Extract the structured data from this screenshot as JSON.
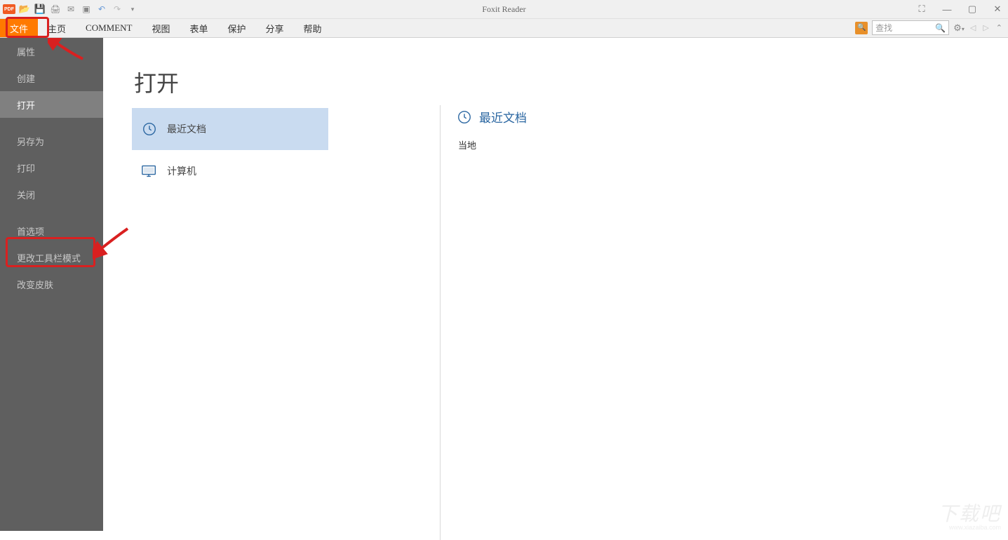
{
  "app": {
    "title": "Foxit Reader"
  },
  "ribbon": {
    "tabs": [
      "文件",
      "主页",
      "COMMENT",
      "视图",
      "表单",
      "保护",
      "分享",
      "帮助"
    ],
    "search_placeholder": "查找"
  },
  "sidebar": {
    "items": [
      {
        "label": "属性"
      },
      {
        "label": "创建"
      },
      {
        "label": "打开",
        "selected": true
      },
      {
        "sep": true
      },
      {
        "label": "另存为"
      },
      {
        "label": "打印"
      },
      {
        "label": "关闭"
      },
      {
        "sep": true
      },
      {
        "label": "首选项"
      },
      {
        "label": "更改工具栏模式"
      },
      {
        "label": "改变皮肤"
      }
    ]
  },
  "main": {
    "title": "打开",
    "open_sources": [
      {
        "label": "最近文档",
        "icon": "clock",
        "active": true
      },
      {
        "label": "计算机",
        "icon": "computer"
      }
    ],
    "recent": {
      "title": "最近文档",
      "subtitle": "当地"
    }
  },
  "watermark": {
    "main": "下载吧",
    "sub": "www.xiazaiba.com"
  }
}
